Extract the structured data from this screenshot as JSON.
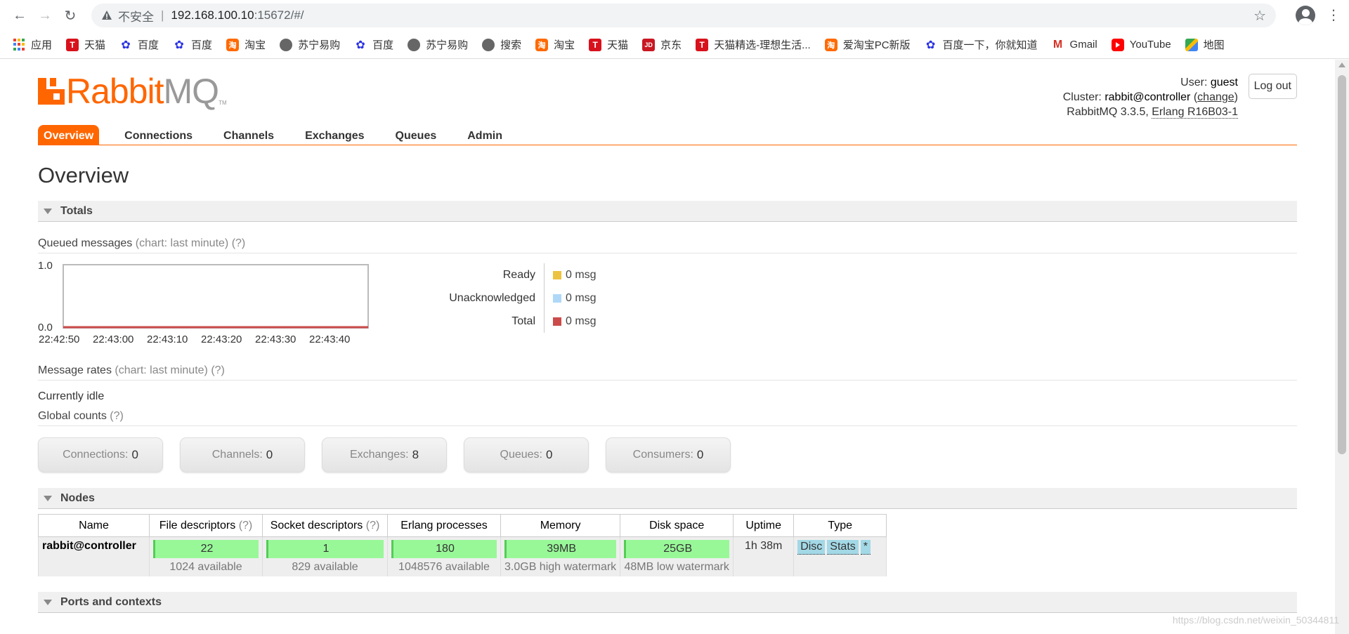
{
  "browser": {
    "security_label": "不安全",
    "url_host": "192.168.100.10",
    "url_rest": ":15672/#/"
  },
  "bookmarks": [
    {
      "label": "应用",
      "icon": "apps-grid-icon"
    },
    {
      "label": "天猫",
      "icon": "tmall-icon"
    },
    {
      "label": "百度",
      "icon": "baidu-paw-icon"
    },
    {
      "label": "百度",
      "icon": "baidu-paw-icon"
    },
    {
      "label": "淘宝",
      "icon": "taobao-icon"
    },
    {
      "label": "苏宁易购",
      "icon": "globe-icon"
    },
    {
      "label": "百度",
      "icon": "baidu-paw-icon"
    },
    {
      "label": "苏宁易购",
      "icon": "globe-icon"
    },
    {
      "label": "搜索",
      "icon": "globe-icon"
    },
    {
      "label": "淘宝",
      "icon": "taobao-icon"
    },
    {
      "label": "天猫",
      "icon": "tmall-icon"
    },
    {
      "label": "京东",
      "icon": "jd-icon"
    },
    {
      "label": "天猫精选-理想生活...",
      "icon": "tmall-icon"
    },
    {
      "label": "爱淘宝PC新版",
      "icon": "taobao-icon"
    },
    {
      "label": "百度一下，你就知道",
      "icon": "baidu-paw-icon"
    },
    {
      "label": "Gmail",
      "icon": "gmail-icon"
    },
    {
      "label": "YouTube",
      "icon": "youtube-icon"
    },
    {
      "label": "地图",
      "icon": "maps-icon"
    }
  ],
  "header": {
    "user_prefix": "User:",
    "user": "guest",
    "cluster_prefix": "Cluster:",
    "cluster": "rabbit@controller",
    "change_label": "change",
    "version": "RabbitMQ 3.3.5,",
    "erlang": "Erlang R16B03-1",
    "logout_label": "Log out"
  },
  "tabs": [
    {
      "label": "Overview",
      "active": true
    },
    {
      "label": "Connections"
    },
    {
      "label": "Channels"
    },
    {
      "label": "Exchanges"
    },
    {
      "label": "Queues"
    },
    {
      "label": "Admin"
    }
  ],
  "page_title": "Overview",
  "totals": {
    "section_label": "Totals",
    "queued_label": "Queued messages",
    "chart_hint": "(chart: last minute)",
    "help": "(?)",
    "rates_label": "Message rates",
    "idle_text": "Currently idle",
    "global_label": "Global counts"
  },
  "chart_data": {
    "type": "line",
    "x": [
      "22:42:50",
      "22:43:00",
      "22:43:10",
      "22:43:20",
      "22:43:30",
      "22:43:40"
    ],
    "yticks": [
      "1.0",
      "0.0"
    ],
    "ylim": [
      0,
      1
    ],
    "series": [
      {
        "name": "Ready",
        "values": [
          0,
          0,
          0,
          0,
          0,
          0
        ],
        "color": "#edc240"
      },
      {
        "name": "Unacknowledged",
        "values": [
          0,
          0,
          0,
          0,
          0,
          0
        ],
        "color": "#afd8f8"
      },
      {
        "name": "Total",
        "values": [
          0,
          0,
          0,
          0,
          0,
          0
        ],
        "color": "#cb4b4b"
      }
    ]
  },
  "legend": [
    {
      "label": "Ready",
      "value": "0 msg",
      "color": "#edc240"
    },
    {
      "label": "Unacknowledged",
      "value": "0 msg",
      "color": "#afd8f8"
    },
    {
      "label": "Total",
      "value": "0 msg",
      "color": "#cb4b4b"
    }
  ],
  "global_counts": [
    {
      "label": "Connections:",
      "value": "0"
    },
    {
      "label": "Channels:",
      "value": "0"
    },
    {
      "label": "Exchanges:",
      "value": "8"
    },
    {
      "label": "Queues:",
      "value": "0"
    },
    {
      "label": "Consumers:",
      "value": "0"
    }
  ],
  "nodes": {
    "section_label": "Nodes",
    "headers": {
      "name": "Name",
      "fd": "File descriptors",
      "sd": "Socket descriptors",
      "erl": "Erlang processes",
      "mem": "Memory",
      "disk": "Disk space",
      "uptime": "Uptime",
      "type": "Type",
      "help": "(?)"
    },
    "row": {
      "name": "rabbit@controller",
      "fd_used": "22",
      "fd_avail": "1024 available",
      "sd_used": "1",
      "sd_avail": "829 available",
      "erl_used": "180",
      "erl_avail": "1048576 available",
      "mem_used": "39MB",
      "mem_sub": "3.0GB high watermark",
      "disk_free": "25GB",
      "disk_sub": "48MB low watermark",
      "uptime": "1h 38m",
      "types": [
        "Disc",
        "Stats",
        "*"
      ]
    }
  },
  "ports_section_label": "Ports and contexts",
  "watermark": "https://blog.csdn.net/weixin_50344811"
}
